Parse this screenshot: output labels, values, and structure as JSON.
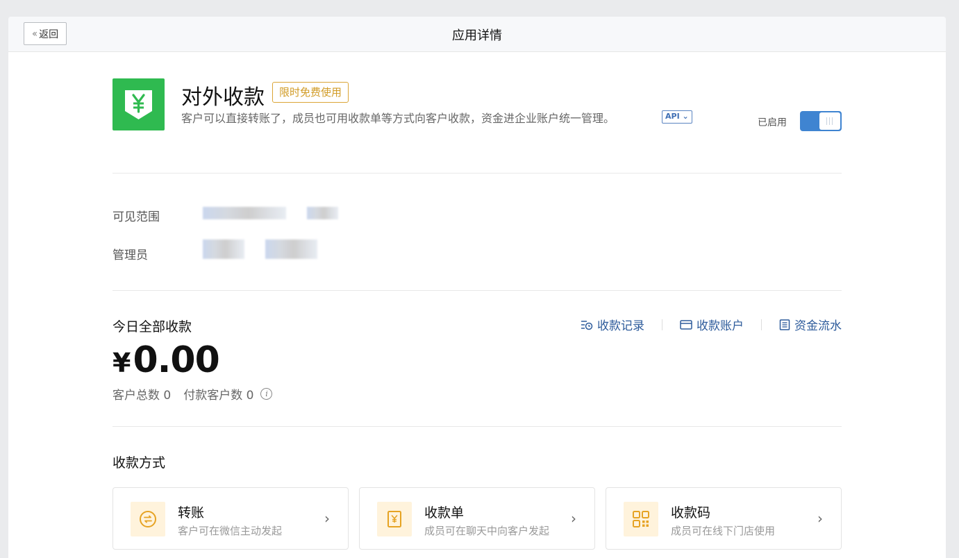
{
  "header": {
    "back_label": "返回",
    "title": "应用详情"
  },
  "app": {
    "name": "对外收款",
    "tag": "限时免费使用",
    "description": "客户可以直接转账了，成员也可用收款单等方式向客户收款，资金进企业账户统一管理。",
    "api_badge": "API ⌄",
    "status_label": "已启用",
    "enabled": true,
    "icon_color": "#2fba50"
  },
  "details": {
    "visibility_label": "可见范围",
    "admin_label": "管理员"
  },
  "today": {
    "title": "今日全部收款",
    "currency": "¥",
    "amount": "0.00",
    "total_customers": "客户总数 0",
    "paying_customers": "付款客户数 0",
    "links": [
      {
        "label": "收款记录",
        "icon": "records-icon"
      },
      {
        "label": "收款账户",
        "icon": "account-card-icon"
      },
      {
        "label": "资金流水",
        "icon": "ledger-icon"
      }
    ]
  },
  "methods": {
    "title": "收款方式",
    "items": [
      {
        "title": "转账",
        "subtitle": "客户可在微信主动发起",
        "icon": "transfer-icon"
      },
      {
        "title": "收款单",
        "subtitle": "成员可在聊天中向客户发起",
        "icon": "bill-icon"
      },
      {
        "title": "收款码",
        "subtitle": "成员可在线下门店使用",
        "icon": "qrcode-icon"
      }
    ]
  },
  "colors": {
    "accent_blue": "#3f84d1",
    "link_blue": "#2d5b9b",
    "tag_orange": "#d19b25",
    "method_icon_bg": "#fff3dc",
    "method_icon_fg": "#e6a323"
  }
}
